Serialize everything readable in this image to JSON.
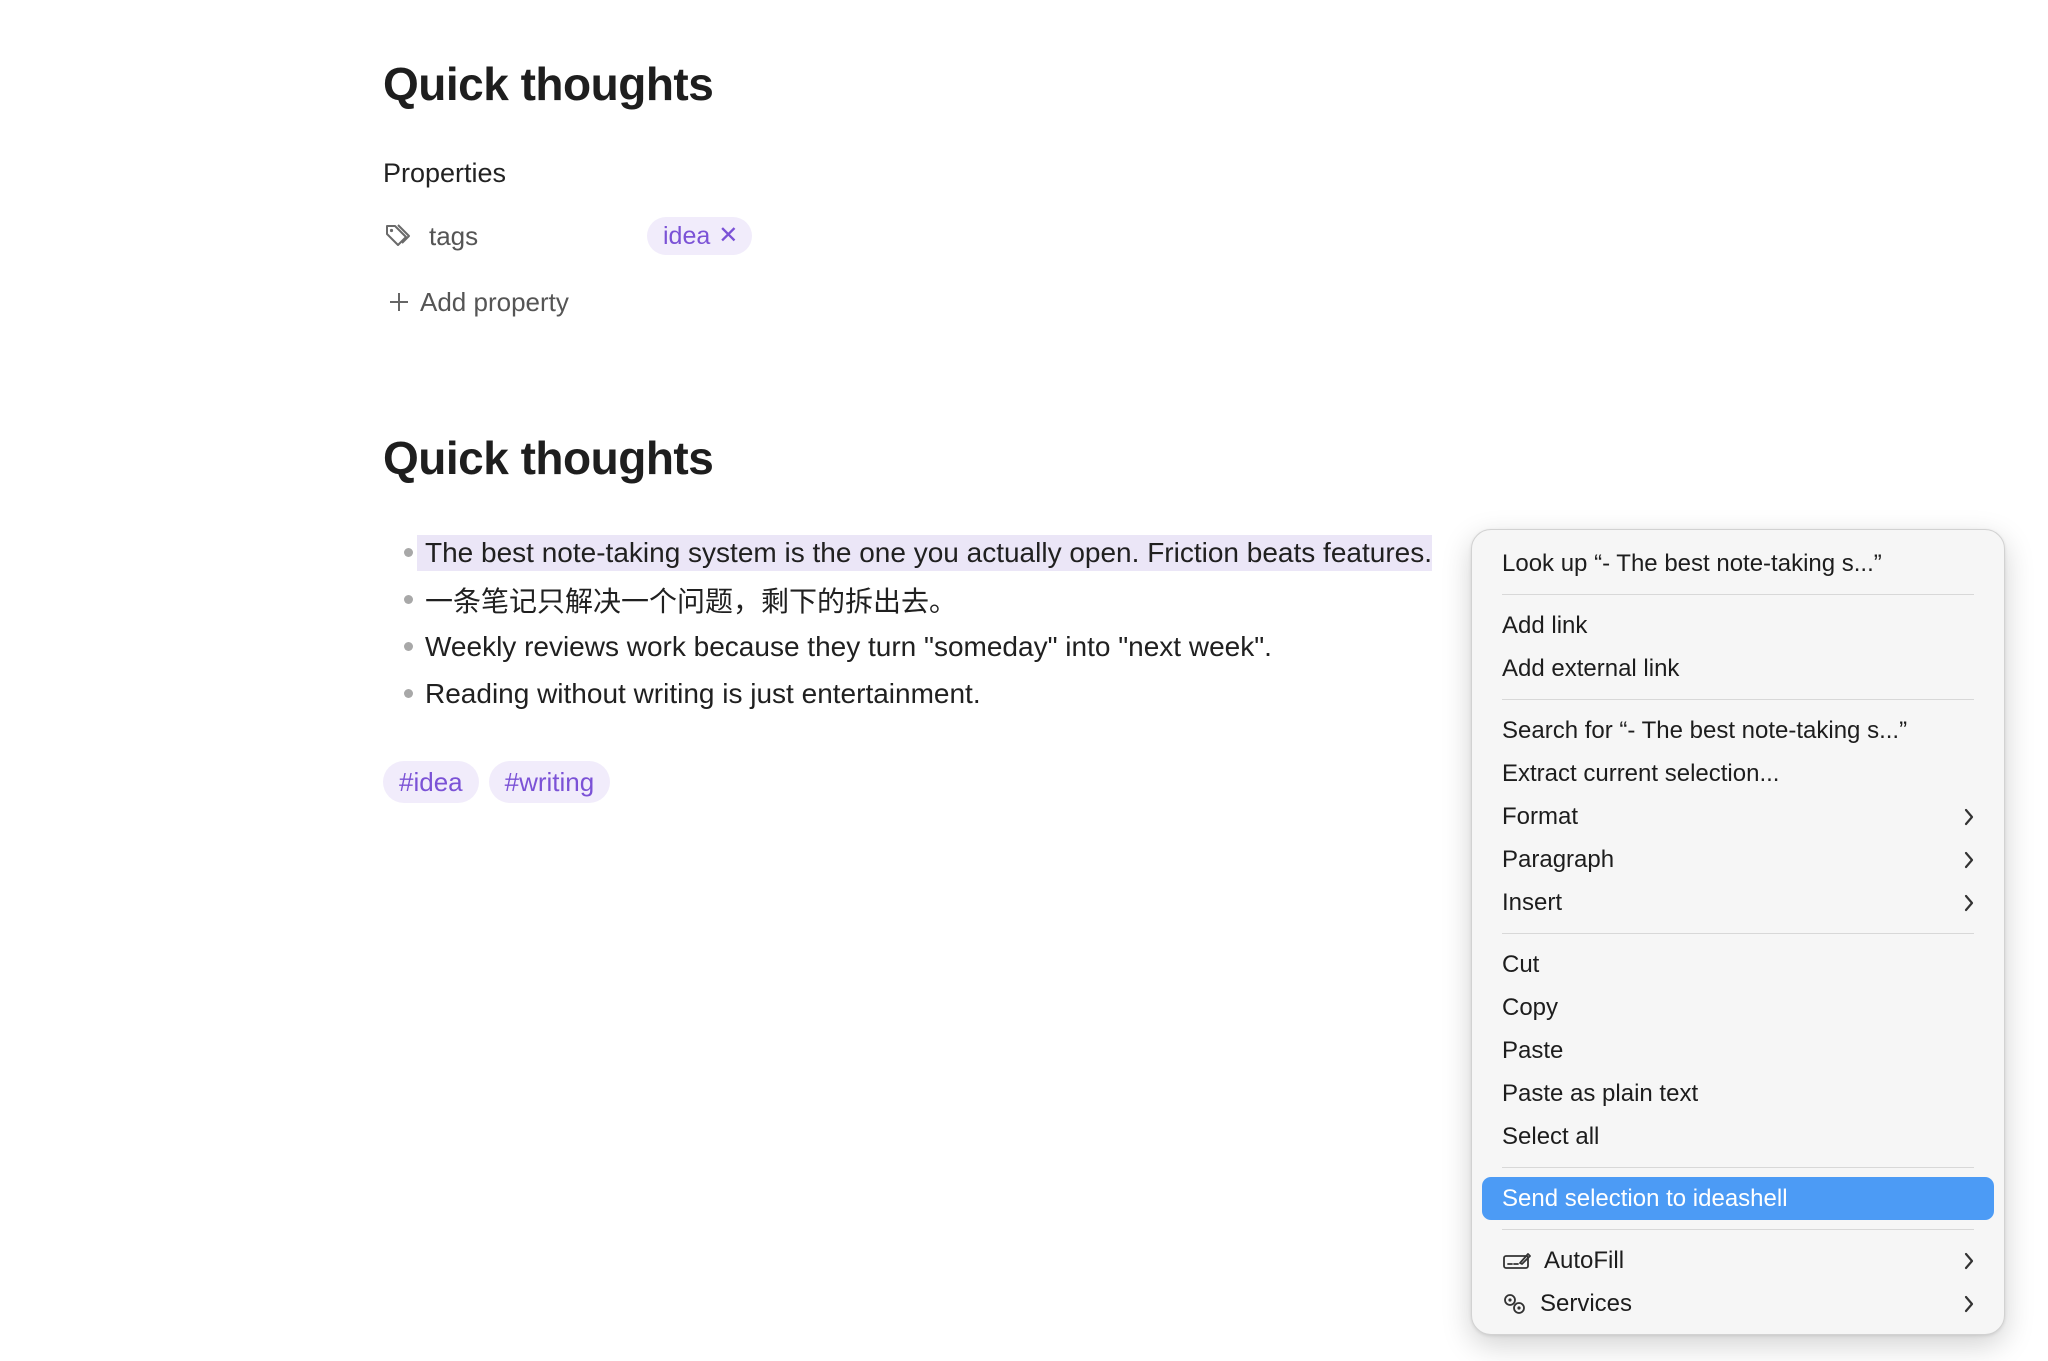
{
  "note": {
    "title": "Quick thoughts",
    "properties_heading": "Properties",
    "property": {
      "name": "tags",
      "value": "idea",
      "remove_glyph": "✕"
    },
    "add_property_label": "Add property",
    "body_title": "Quick thoughts",
    "bullets": [
      "The best note-taking system is the one you actually open. Friction beats features.",
      "一条笔记只解决一个问题，剩下的拆出去。",
      "Weekly reviews work because they turn \"someday\" into \"next week\".",
      "Reading without writing is just entertainment."
    ],
    "inline_tags": [
      "#idea",
      "#writing"
    ]
  },
  "context_menu": {
    "look_up": "Look up “- The best note-taking s...”",
    "add_link": "Add link",
    "add_external_link": "Add external link",
    "search_for": "Search for “- The best note-taking s...”",
    "extract_selection": "Extract current selection...",
    "format": "Format",
    "paragraph": "Paragraph",
    "insert": "Insert",
    "cut": "Cut",
    "copy": "Copy",
    "paste": "Paste",
    "paste_plain": "Paste as plain text",
    "select_all": "Select all",
    "send_selection": "Send selection to ideashell",
    "autofill": "AutoFill",
    "services": "Services"
  },
  "colors": {
    "accent_purple": "#7b52d6",
    "tag_bg": "#f1ecfb",
    "selection_bg": "#ebe6f7",
    "menu_highlight": "#4c9bf5"
  },
  "icons": {
    "property": "tag-icon",
    "add": "plus-icon",
    "submenu": "chevron-right-icon",
    "autofill": "autofill-icon",
    "services": "services-icon"
  }
}
